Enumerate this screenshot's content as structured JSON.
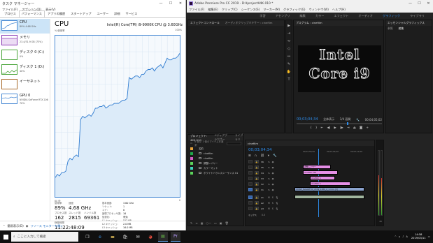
{
  "task_manager": {
    "title": "タスク マネージャー",
    "menu": [
      "ファイル(F)",
      "オプション(O)",
      "表示(V)"
    ],
    "tabs": [
      "プロセス",
      "パフォーマンス",
      "アプリの履歴",
      "スタートアップ",
      "ユーザー",
      "詳細",
      "サービス"
    ],
    "active_tab_index": 1,
    "sidebar": [
      {
        "label": "CPU",
        "sub": "89% 4.68 GHz",
        "icon": "cpu-graph-icon",
        "active": true
      },
      {
        "label": "メモリ",
        "sub": "23.4/31.9 GB (73%)",
        "icon": "memory-graph-icon"
      },
      {
        "label": "ディスク 0 (C:)",
        "sub": "0%",
        "icon": "disk-graph-icon"
      },
      {
        "label": "ディスク 1 (D:)",
        "sub": "40%",
        "icon": "disk-graph-icon"
      },
      {
        "label": "イーサネット",
        "sub": "",
        "icon": "ethernet-graph-icon"
      },
      {
        "label": "GPU 0",
        "sub": "NVIDIA GeForce RTX 206",
        "sub2": "70%",
        "icon": "gpu-graph-icon"
      }
    ],
    "cpu": {
      "title": "CPU",
      "model": "Intel(R) Core(TM) i9-9900K CPU @ 3.60GHz",
      "graph_label_left": "% 使用率",
      "graph_label_right": "100%",
      "axis_left": "60 秒",
      "axis_right": "0",
      "utilization_label": "使用率",
      "utilization": "89%",
      "speed_label": "速度",
      "speed": "4.68 GHz",
      "processes_label": "プロセス数",
      "processes": "162",
      "threads_label": "スレッド数",
      "threads": "2815",
      "handles_label": "ハンドル数",
      "handles": "69361",
      "uptime_label": "稼働時間",
      "uptime": "11:22:48:09",
      "specs": [
        {
          "k": "基本速度:",
          "v": "3.60 GHz"
        },
        {
          "k": "ソケット:",
          "v": "1"
        },
        {
          "k": "コア:",
          "v": "8"
        },
        {
          "k": "論理プロセッサ数:",
          "v": "16"
        },
        {
          "k": "仮想化:",
          "v": "有効"
        },
        {
          "k": "L1 キャッシュ:",
          "v": "512 KB"
        },
        {
          "k": "L2 キャッシュ:",
          "v": "2.0 MB"
        },
        {
          "k": "L3 キャッシュ:",
          "v": "16.0 MB"
        }
      ],
      "usage_history": [
        12,
        14,
        13,
        15,
        15,
        16,
        22,
        24,
        23,
        25,
        26,
        25,
        48,
        50,
        49,
        50,
        51,
        50,
        52,
        55,
        55,
        56,
        56,
        57,
        55,
        56,
        57,
        57,
        58,
        58,
        58,
        59,
        60,
        60,
        61,
        74,
        73,
        74,
        75,
        75,
        74,
        76,
        76,
        78,
        79,
        79,
        80,
        78,
        80,
        81,
        82,
        80,
        83,
        86,
        85,
        85,
        86,
        86,
        87,
        89
      ]
    },
    "footer_brief": "簡易表示(D)",
    "footer_link": "リソース モニターを開く"
  },
  "premiere": {
    "title": "Adobe Premiere Pro CC 2019 - D:¥project¥4K.010 *",
    "menu": [
      "ファイル(F)",
      "編集(E)",
      "クリップ(C)",
      "シーケンス(S)",
      "マーカー(M)",
      "グラフィック(G)",
      "ウィンドウ(W)",
      "ヘルプ(H)"
    ],
    "workspaces": [
      "学習",
      "アセンブリ",
      "編集",
      "カラー",
      "エフェクト",
      "オーディオ",
      "グラフィック",
      "ライブラリ"
    ],
    "active_workspace_index": 6,
    "source_tabs": [
      "エフェクトコントロール",
      "オーディオクリップミキサー : cinefilm"
    ],
    "program_tab": "プログラム : cinefilm",
    "essential_tab": "エッセンシャルグラフィックス",
    "essential_sub": [
      "参照",
      "編集"
    ],
    "video_text_line1": "Intel",
    "video_text_line2": "Core i9",
    "program_timecode": "00;03;04;34",
    "program_fit": "全体表示",
    "program_quality": "1/4 画質",
    "program_duration": "00;04;05;02",
    "project_tabs": [
      "プロジェクト: 4K0.010",
      "メディアブラウザー",
      "ライブラリ"
    ],
    "project_items": [
      {
        "color": "#e6a23c",
        "name": "名前"
      },
      {
        "color": "#1fa84a",
        "name": "cinefilm"
      },
      {
        "color": "#d45bc8",
        "name": "cinefilm"
      },
      {
        "color": "#5bd45b",
        "name": "調整レイヤー"
      },
      {
        "color": "#3fd4bb",
        "name": "カラーマット"
      },
      {
        "color": "#5bd45b",
        "name": "ホワイトバランスシーケンス 01"
      }
    ],
    "project_count": "6 個中 1 個のアイテムを選択",
    "timeline_tab": "cinefilm",
    "timeline_timecode": "00;03;04;34",
    "ruler": [
      "00;02;56;00",
      "00;03;04;00",
      "00;03;12;00"
    ],
    "tracks_video": [
      "V6",
      "V5",
      "V4",
      "V3",
      "V2",
      "V1"
    ],
    "tracks_audio": [
      "A1",
      "A2",
      "A3"
    ],
    "master_label": "ミックス",
    "master_value": "0.0",
    "clips": [
      {
        "track": "V5",
        "color": "pink",
        "label": "調整レイヤー",
        "x": 82,
        "w": 40
      },
      {
        "track": "V4",
        "color": "pink",
        "label": "cinefilm T03",
        "x": 82,
        "w": 50
      },
      {
        "track": "V3",
        "color": "pink",
        "label": "cinefilm 1",
        "x": 92,
        "w": 36
      },
      {
        "track": "V2",
        "color": "pink",
        "label": "cinefilm 1",
        "x": 92,
        "w": 58
      },
      {
        "track": "V1",
        "color": "blue",
        "label": "SHINE_MAGNETIC_2019_2480_2_1.mov [V]",
        "x": 70,
        "w": 100
      }
    ],
    "meter_scale": "dB",
    "meter_levels": [
      0.62,
      0.58
    ]
  },
  "taskbar": {
    "search_placeholder": "ここに入力して検索",
    "apps": [
      "task-view-icon",
      "edge-icon",
      "explorer-icon",
      "store-icon",
      "mail-icon",
      "chrome-icon",
      "taskmgr-icon",
      "premiere-icon"
    ],
    "time": "14:58",
    "date": "2019/03/11",
    "ime": "A"
  }
}
